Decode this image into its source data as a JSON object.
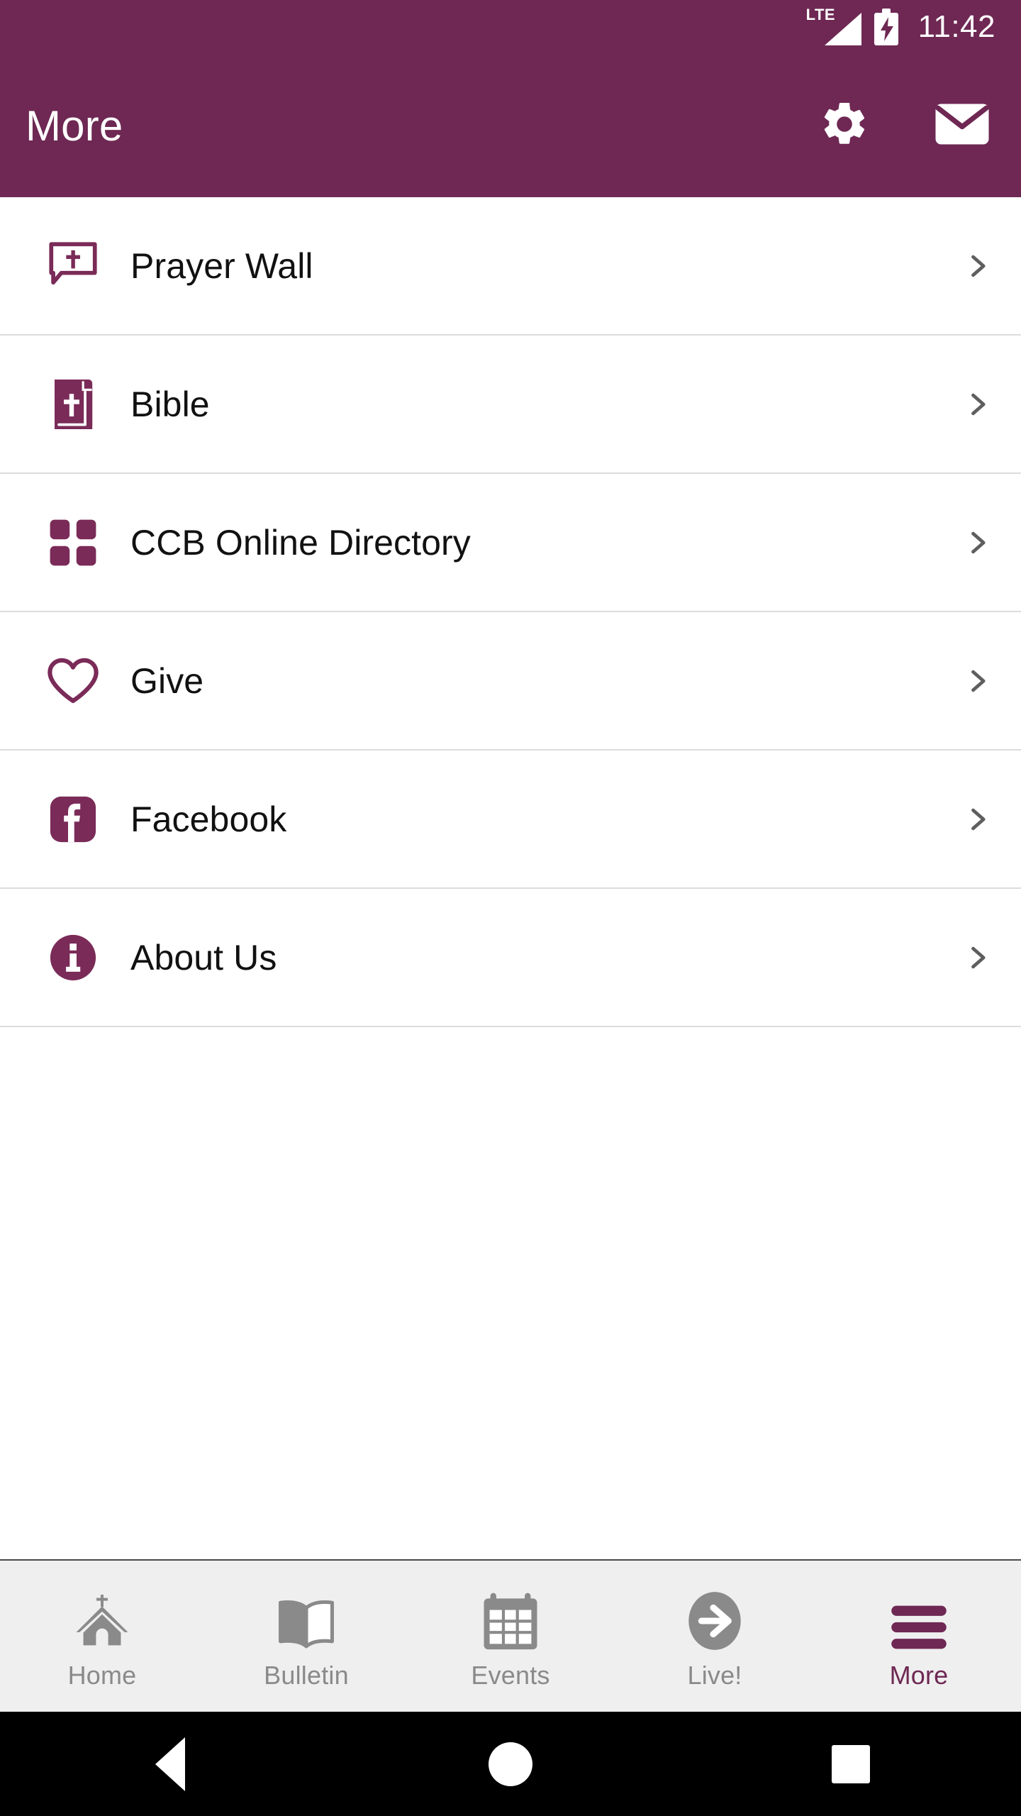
{
  "status_bar": {
    "network_label": "LTE",
    "network_icon": "signal-bars-icon",
    "battery_icon": "battery-charging-icon",
    "time": "11:42"
  },
  "app_bar": {
    "title": "More",
    "actions": [
      {
        "name": "settings-button",
        "icon": "gear-icon"
      },
      {
        "name": "mail-button",
        "icon": "envelope-icon"
      }
    ]
  },
  "menu": {
    "items": [
      {
        "label": "Prayer Wall",
        "icon": "speech-bubble-cross-icon",
        "chevron": "chevron-right-icon"
      },
      {
        "label": "Bible",
        "icon": "bible-book-icon",
        "chevron": "chevron-right-icon"
      },
      {
        "label": "CCB Online Directory",
        "icon": "grid-squares-icon",
        "chevron": "chevron-right-icon"
      },
      {
        "label": "Give",
        "icon": "heart-outline-icon",
        "chevron": "chevron-right-icon"
      },
      {
        "label": "Facebook",
        "icon": "facebook-icon",
        "chevron": "chevron-right-icon"
      },
      {
        "label": "About Us",
        "icon": "info-circle-icon",
        "chevron": "chevron-right-icon"
      }
    ]
  },
  "bottom_nav": {
    "tabs": [
      {
        "label": "Home",
        "icon": "church-icon",
        "active": false
      },
      {
        "label": "Bulletin",
        "icon": "open-book-icon",
        "active": false
      },
      {
        "label": "Events",
        "icon": "calendar-icon",
        "active": false
      },
      {
        "label": "Live!",
        "icon": "arrow-circle-icon",
        "active": false
      },
      {
        "label": "More",
        "icon": "hamburger-icon",
        "active": true
      }
    ]
  },
  "android_nav": {
    "back": "back-triangle-icon",
    "home": "home-circle-icon",
    "recents": "recents-square-icon"
  },
  "colors": {
    "brand_purple": "#6E2853",
    "status_bar": "#6E2853",
    "nav_inactive": "#8A8A8A",
    "divider": "#DCDCDC",
    "bottom_nav_bg": "#EFEFEF",
    "text_primary": "#111111"
  }
}
